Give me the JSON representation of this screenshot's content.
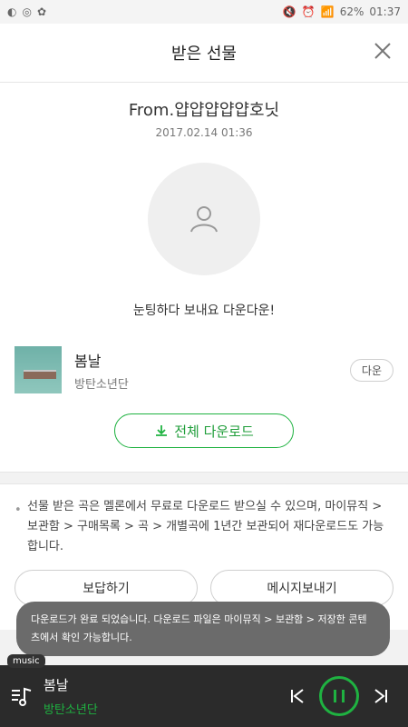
{
  "status_bar": {
    "battery": "62%",
    "time": "01:37"
  },
  "header": {
    "title": "받은 선물"
  },
  "gift": {
    "from": "From.얍얍얍얍얍호닛",
    "date": "2017.02.14 01:36",
    "message": "눈팅하다 보내요 다운다운!"
  },
  "song": {
    "title": "봄날",
    "artist": "방탄소년단",
    "download_label": "다운"
  },
  "download_all_label": "전체 다운로드",
  "notice": {
    "text": "선물 받은 곡은 멜론에서 무료로 다운로드 받으실 수 있으며, 마이뮤직 > 보관함 > 구매목록 > 곡 > 개별곡에 1년간 보관되어 재다운로드도 가능합니다."
  },
  "actions": {
    "reply_label": "보답하기",
    "message_label": "메시지보내기"
  },
  "toast": {
    "text": "다운로드가 완료 되었습니다. 다운로드 파일은 마이뮤직 > 보관함 > 저장한 콘텐츠에서 확인 가능합니다."
  },
  "player": {
    "tag": "music",
    "title": "봄날",
    "artist": "방탄소년단"
  },
  "colors": {
    "accent_green": "#1fb241",
    "player_bg": "#2b2b2b"
  }
}
